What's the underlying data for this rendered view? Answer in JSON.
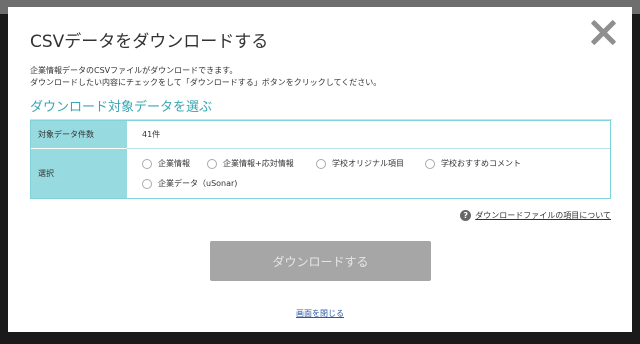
{
  "modal": {
    "title": "CSVデータをダウンロードする",
    "description_line1": "企業情報データのCSVファイルがダウンロードできます。",
    "description_line2": "ダウンロードしたい内容にチェックをして「ダウンロードする」ボタンをクリックしてください。",
    "section_title": "ダウンロード対象データを選ぶ",
    "table": {
      "count_label": "対象データ件数",
      "count_value": "41件",
      "select_label": "選択",
      "options": [
        {
          "label": "企業情報",
          "checked": false
        },
        {
          "label": "企業情報+応対情報",
          "checked": false
        },
        {
          "label": "学校オリジナル項目",
          "checked": false
        },
        {
          "label": "学校おすすめコメント",
          "checked": false
        },
        {
          "label": "企業データ（uSonar)",
          "checked": false
        }
      ]
    },
    "help_icon": "question-circle-icon",
    "help_link": "ダウンロードファイルの項目について",
    "download_button": "ダウンロードする",
    "close_link": "画面を閉じる",
    "close_icon": "close-x-icon"
  },
  "colors": {
    "accent": "#37a7b1",
    "table_header_bg": "#97dbe1",
    "button_disabled": "#a6a6a6",
    "link": "#2f59a8"
  }
}
